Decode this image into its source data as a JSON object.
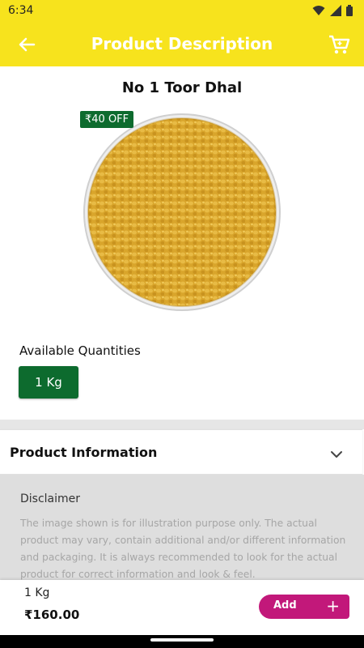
{
  "status_bar": {
    "time": "6:34"
  },
  "app_bar": {
    "title": "Product Description"
  },
  "product": {
    "name": "No 1 Toor Dhal",
    "offer_badge": "₹40 OFF",
    "available_quantities_label": "Available Quantities",
    "quantities": [
      "1 Kg"
    ]
  },
  "product_information": {
    "label": "Product Information"
  },
  "disclaimer": {
    "title": "Disclaimer",
    "text": "The image shown is for illustration purpose only. The actual product may vary, contain additional and/or different information and packaging. It is always recommended to look for the actual product for correct information and look & feel."
  },
  "bottom_bar": {
    "quantity": "1 Kg",
    "price": "₹160.00",
    "add_label": "Add",
    "add_icon": "+"
  },
  "colors": {
    "accent_yellow": "#f7e31d",
    "offer_green": "#0d6b2e",
    "add_magenta": "#c2187a"
  },
  "icons": [
    "wifi-icon",
    "signal-icon",
    "battery-icon",
    "back-arrow-icon",
    "cart-icon",
    "chevron-down-icon",
    "plus-icon"
  ]
}
